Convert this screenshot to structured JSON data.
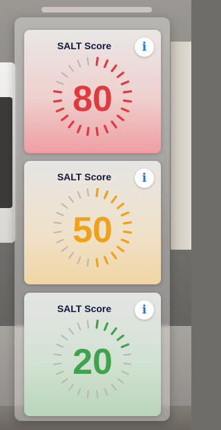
{
  "cards": [
    {
      "title": "SALT Score",
      "info_label": "i",
      "score": "80",
      "value": 80,
      "color": "#e03a3e"
    },
    {
      "title": "SALT Score",
      "info_label": "i",
      "score": "50",
      "value": 50,
      "color": "#f0a11a"
    },
    {
      "title": "SALT Score",
      "info_label": "i",
      "score": "20",
      "value": 20,
      "color": "#3fa34d"
    }
  ],
  "colors": {
    "inactive_tick": "#b9b5b1",
    "title": "#12173d",
    "info": "#1976d2"
  },
  "icons": {
    "info": "info-icon"
  }
}
